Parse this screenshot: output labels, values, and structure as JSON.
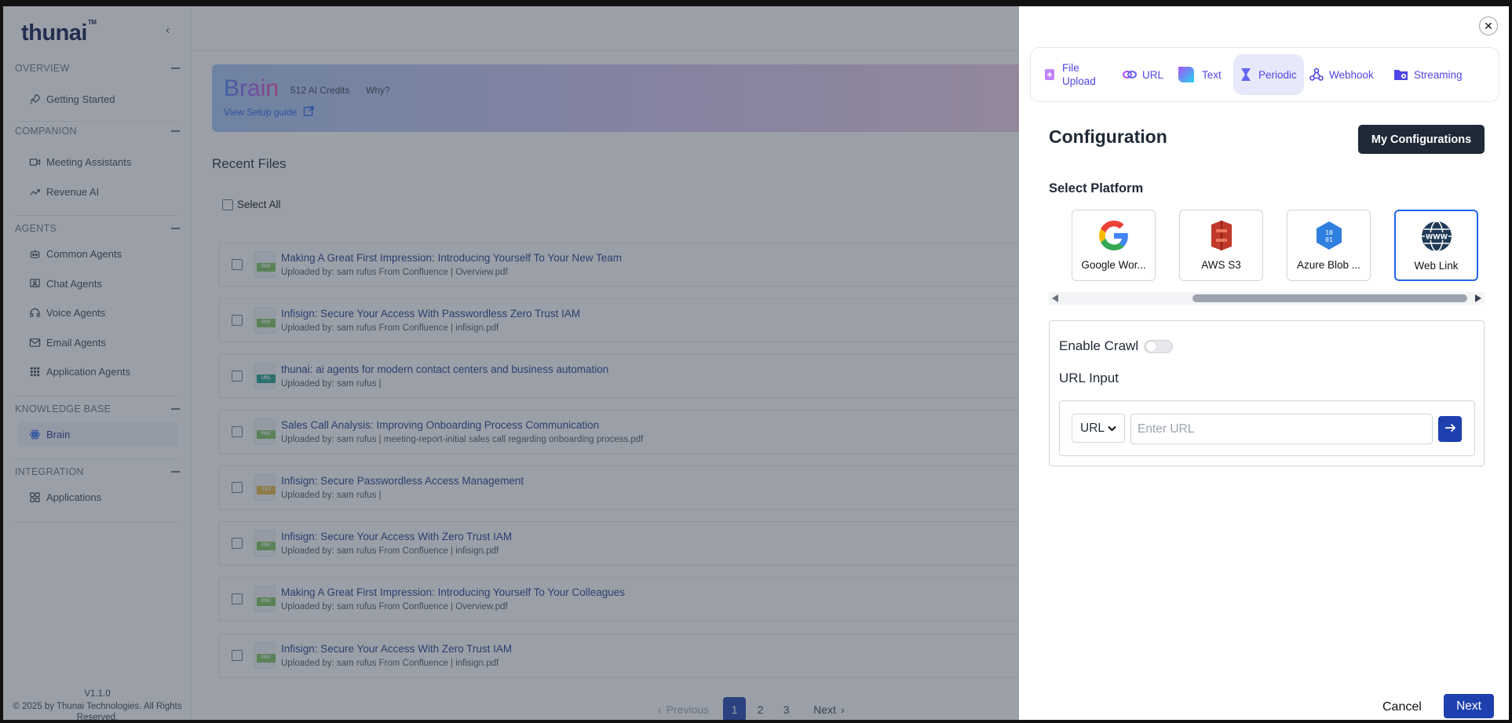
{
  "app": {
    "logo": "thunai",
    "tm": "TM"
  },
  "sidebar": {
    "sections": [
      {
        "title": "OVERVIEW",
        "items": [
          {
            "label": "Getting Started"
          }
        ]
      },
      {
        "title": "COMPANION",
        "items": [
          {
            "label": "Meeting Assistants"
          },
          {
            "label": "Revenue AI"
          }
        ]
      },
      {
        "title": "AGENTS",
        "items": [
          {
            "label": "Common Agents"
          },
          {
            "label": "Chat Agents"
          },
          {
            "label": "Voice Agents"
          },
          {
            "label": "Email Agents"
          },
          {
            "label": "Application Agents"
          }
        ]
      },
      {
        "title": "KNOWLEDGE BASE",
        "items": [
          {
            "label": "Brain"
          }
        ]
      },
      {
        "title": "INTEGRATION",
        "items": [
          {
            "label": "Applications"
          }
        ]
      }
    ],
    "version": "V1.1.0",
    "copyright": "© 2025 by Thunai Technologies. All Rights Reserved."
  },
  "banner": {
    "title": "Brain",
    "credits": "512 AI Credits",
    "why": "Why?",
    "guide": "View Setup guide"
  },
  "recent": {
    "title": "Recent Files",
    "select_all": "Select All",
    "files": [
      {
        "type": "PDF",
        "title": "Making A Great First Impression: Introducing Yourself To Your New Team",
        "sub": "Uploaded by: sam rufus From Confluence | Overview.pdf"
      },
      {
        "type": "PDF",
        "title": "Infisign: Secure Your Access With Passwordless Zero Trust IAM",
        "sub": "Uploaded by: sam rufus From Confluence | infisign.pdf"
      },
      {
        "type": "URL",
        "title": "thunai: ai agents for modern contact centers and business automation",
        "sub": "Uploaded by: sam rufus |"
      },
      {
        "type": "PDF",
        "title": "Sales Call Analysis: Improving Onboarding Process Communication",
        "sub": "Uploaded by: sam rufus | meeting-report-initial sales call regarding onboarding process.pdf"
      },
      {
        "type": "TXT",
        "title": "Infisign: Secure Passwordless Access Management",
        "sub": "Uploaded by: sam rufus |"
      },
      {
        "type": "PDF",
        "title": "Infisign: Secure Your Access With Zero Trust IAM",
        "sub": "Uploaded by: sam rufus From Confluence | infisign.pdf"
      },
      {
        "type": "PDF",
        "title": "Making A Great First Impression: Introducing Yourself To Your Colleagues",
        "sub": "Uploaded by: sam rufus From Confluence | Overview.pdf"
      },
      {
        "type": "PDF",
        "title": "Infisign: Secure Your Access With Zero Trust IAM",
        "sub": "Uploaded by: sam rufus From Confluence | infisign.pdf"
      }
    ]
  },
  "pagination": {
    "previous": "Previous",
    "pages": [
      "1",
      "2",
      "3"
    ],
    "current": "1",
    "next": "Next"
  },
  "drawer": {
    "tabs": [
      {
        "label": "File\nUpload",
        "icon": "file-upload-icon"
      },
      {
        "label": "URL",
        "icon": "url-icon"
      },
      {
        "label": "Text",
        "icon": "text-icon"
      },
      {
        "label": "Periodic",
        "icon": "hourglass-icon",
        "active": true
      },
      {
        "label": "Webhook",
        "icon": "webhook-icon"
      },
      {
        "label": "Streaming",
        "icon": "streaming-icon"
      }
    ],
    "config_title": "Configuration",
    "my_configs": "My Configurations",
    "select_platform": "Select Platform",
    "platforms": [
      {
        "label": "Google Wor...",
        "icon": "google-icon"
      },
      {
        "label": "AWS S3",
        "icon": "aws-s3-icon"
      },
      {
        "label": "Azure Blob ...",
        "icon": "azure-blob-icon"
      },
      {
        "label": "Web Link",
        "icon": "web-link-icon",
        "selected": true
      }
    ],
    "enable_crawl": "Enable Crawl",
    "url_input": "URL Input",
    "url_select": "URL",
    "url_placeholder": "Enter URL",
    "cancel": "Cancel",
    "next": "Next"
  },
  "colors": {
    "accent": "#1e40af",
    "tab_text": "#4f46e5",
    "dark_button": "#1f2937"
  }
}
